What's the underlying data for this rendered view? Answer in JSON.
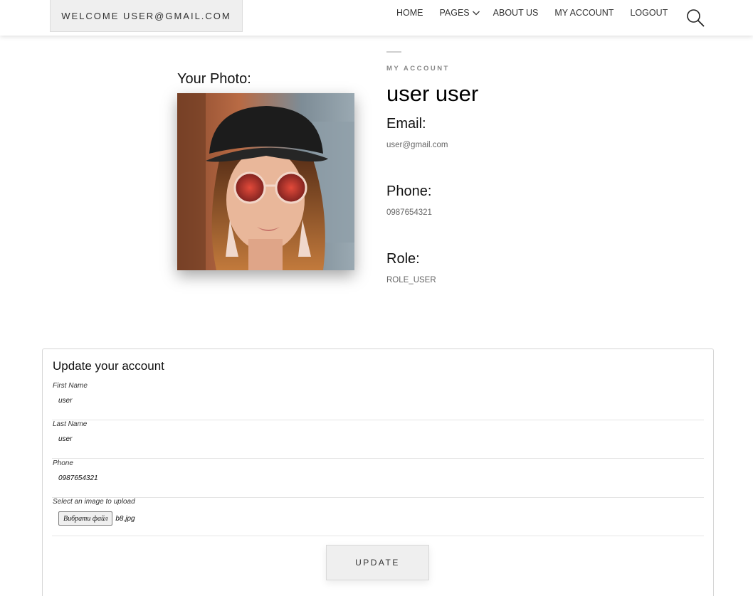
{
  "header": {
    "welcome": "WELCOME USER@GMAIL.COM",
    "nav": [
      {
        "label": "HOME"
      },
      {
        "label": "PAGES",
        "icon": "chevron-down-icon"
      },
      {
        "label": "ABOUT US"
      },
      {
        "label": "MY ACCOUNT"
      },
      {
        "label": "LOGOUT"
      }
    ],
    "search_icon": "search-icon"
  },
  "photo": {
    "label": "Your Photo:"
  },
  "profile": {
    "kicker": "MY ACCOUNT",
    "name": "user user",
    "email_label": "Email:",
    "email": "user@gmail.com",
    "phone_label": "Phone:",
    "phone": "0987654321",
    "role_label": "Role:",
    "role": "ROLE_USER"
  },
  "form": {
    "title": "Update your account",
    "first_name": {
      "label": "First Name",
      "value": "user"
    },
    "last_name": {
      "label": "Last Name",
      "value": "user"
    },
    "phone": {
      "label": "Phone",
      "value": "0987654321"
    },
    "image": {
      "label": "Select an image to upload",
      "button": "Вибрати файл",
      "file_name": "b8.jpg"
    },
    "submit": "UPDATE"
  }
}
